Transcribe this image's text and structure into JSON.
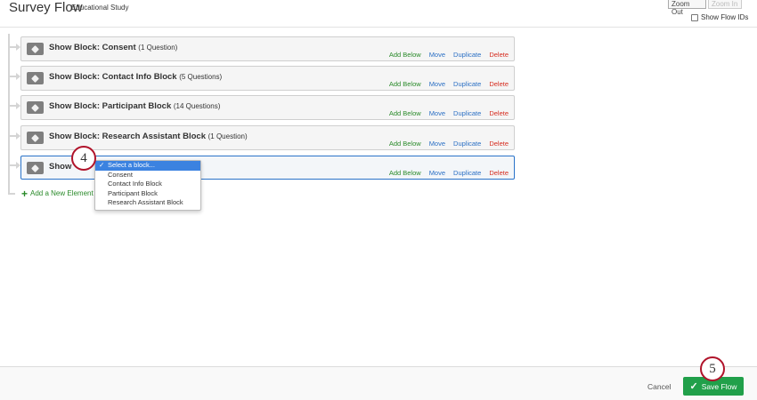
{
  "header": {
    "title": "Survey Flow",
    "subtitle": "Educational Study",
    "zoom_out": "Zoom Out",
    "zoom_in": "Zoom In",
    "show_flow_ids": "Show Flow IDs"
  },
  "actions": {
    "add_below": "Add Below",
    "move": "Move",
    "duplicate": "Duplicate",
    "delete": "Delete"
  },
  "blocks": [
    {
      "title": "Show Block: Consent",
      "count": "(1 Question)"
    },
    {
      "title": "Show Block: Contact Info Block",
      "count": "(5 Questions)"
    },
    {
      "title": "Show Block: Participant Block",
      "count": "(14 Questions)"
    },
    {
      "title": "Show Block: Research Assistant Block",
      "count": "(1 Question)"
    },
    {
      "title": "Show",
      "count": ""
    }
  ],
  "add_element": "Add a New Element",
  "dropdown": {
    "selected": "Select a block...",
    "options": [
      "Consent",
      "Contact Info Block",
      "Participant Block",
      "Research Assistant Block"
    ]
  },
  "badges": [
    "4",
    "5"
  ],
  "footer": {
    "cancel": "Cancel",
    "save": "Save Flow"
  },
  "colors": {
    "accent_green": "#21a04a",
    "link_blue": "#2a6fc4",
    "delete_red": "#d62d20",
    "badge_border": "#b0132a"
  }
}
